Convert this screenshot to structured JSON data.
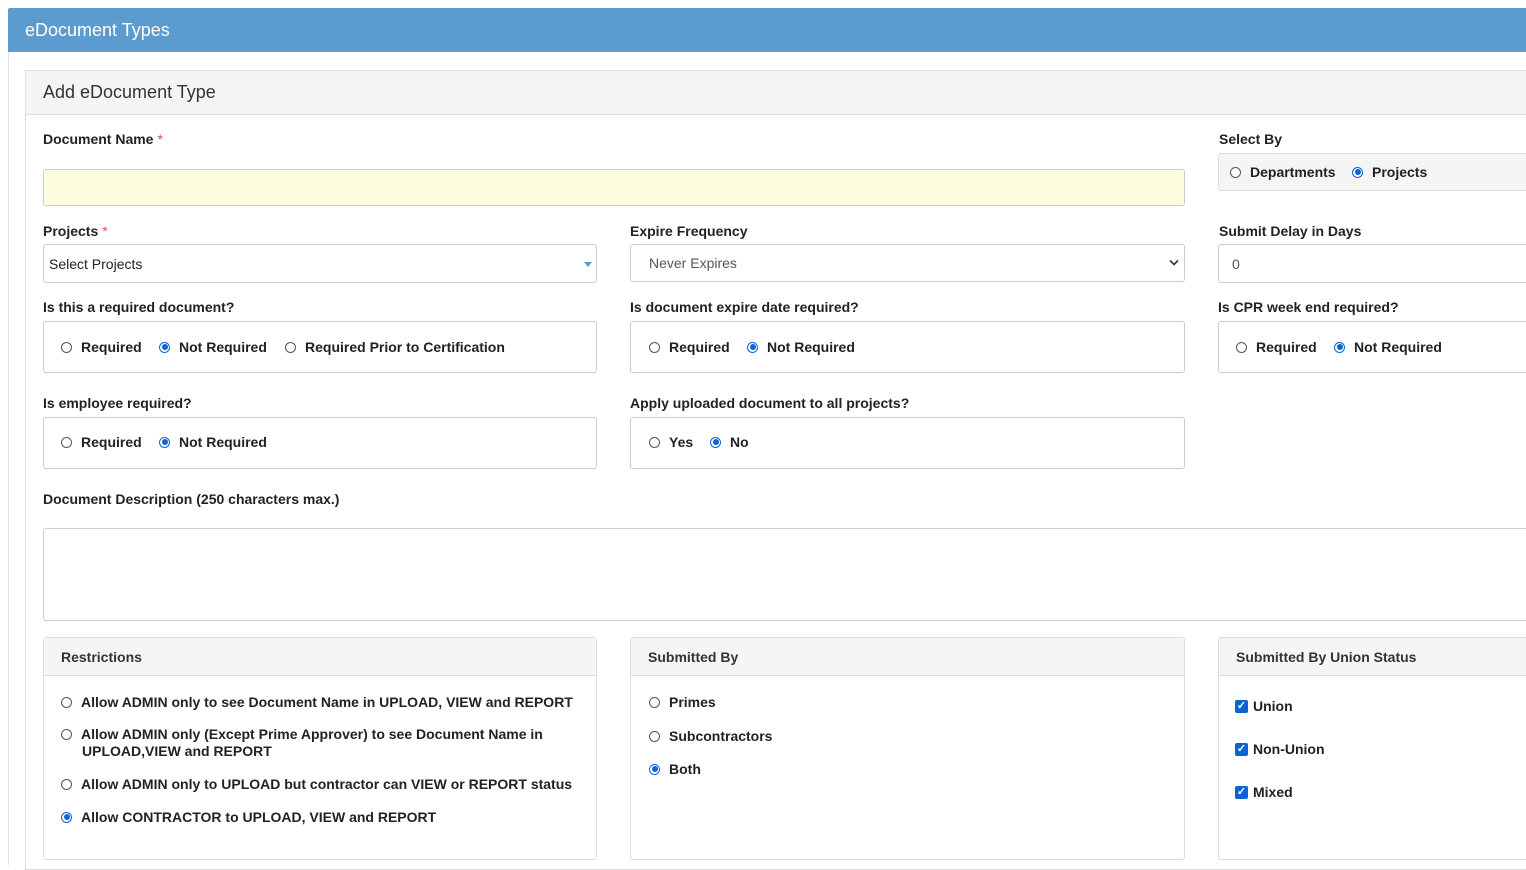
{
  "header": {
    "title": "eDocument Types"
  },
  "panel": {
    "title": "Add eDocument Type"
  },
  "document_name": {
    "label": "Document Name",
    "required_mark": "*",
    "value": ""
  },
  "select_by": {
    "label": "Select By",
    "options": [
      "Departments",
      "Projects"
    ],
    "selected": "Projects"
  },
  "projects": {
    "label": "Projects",
    "required_mark": "*",
    "value": "Select Projects"
  },
  "expire_frequency": {
    "label": "Expire Frequency",
    "value": "Never Expires"
  },
  "submit_delay": {
    "label": "Submit Delay in Days",
    "value": "0"
  },
  "required_document": {
    "label": "Is this a required document?",
    "options": [
      "Required",
      "Not Required",
      "Required Prior to Certification"
    ],
    "selected": "Not Required"
  },
  "expire_date_required": {
    "label": "Is document expire date required?",
    "options": [
      "Required",
      "Not Required"
    ],
    "selected": "Not Required"
  },
  "cpr_week_end": {
    "label": "Is CPR week end required?",
    "options": [
      "Required",
      "Not Required"
    ],
    "selected": "Not Required"
  },
  "employee_required": {
    "label": "Is employee required?",
    "options": [
      "Required",
      "Not Required"
    ],
    "selected": "Not Required"
  },
  "apply_all_projects": {
    "label": "Apply uploaded document to all projects?",
    "options": [
      "Yes",
      "No"
    ],
    "selected": "No"
  },
  "description": {
    "label": "Document Description (250 characters max.)",
    "value": ""
  },
  "restrictions": {
    "title": "Restrictions",
    "options": [
      "Allow ADMIN only to see Document Name in UPLOAD, VIEW and REPORT",
      "Allow ADMIN only (Except Prime Approver) to see Document Name in",
      "UPLOAD,VIEW and REPORT",
      "Allow ADMIN only to UPLOAD but contractor can VIEW or REPORT status",
      "Allow CONTRACTOR to UPLOAD, VIEW and REPORT"
    ],
    "selected_index": 3
  },
  "submitted_by": {
    "title": "Submitted By",
    "options": [
      "Primes",
      "Subcontractors",
      "Both"
    ],
    "selected": "Both"
  },
  "union_status": {
    "title": "Submitted By Union Status",
    "options": [
      "Union",
      "Non-Union",
      "Mixed"
    ],
    "checked": [
      true,
      true,
      true
    ]
  },
  "colors": {
    "header_bg": "#5b9bd0",
    "accent": "#0b63d5",
    "required_mark": "#d9534f",
    "name_field_bg": "#fffde0"
  }
}
